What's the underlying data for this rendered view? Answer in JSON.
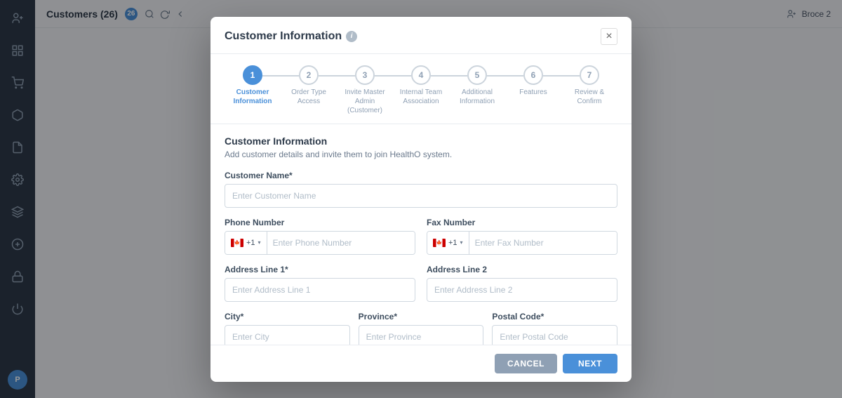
{
  "app": {
    "title": "Customers (26)",
    "badge": "26",
    "user": "Broce 2"
  },
  "sidebar": {
    "icons": [
      {
        "name": "add-user-icon",
        "symbol": "👤",
        "active": false
      },
      {
        "name": "grid-icon",
        "symbol": "⊞",
        "active": false
      },
      {
        "name": "cart-icon",
        "symbol": "🛒",
        "active": false
      },
      {
        "name": "package-icon",
        "symbol": "📦",
        "active": false
      },
      {
        "name": "file-icon",
        "symbol": "📄",
        "active": false
      },
      {
        "name": "settings-icon",
        "symbol": "⚙",
        "active": false
      },
      {
        "name": "layers-icon",
        "symbol": "◫",
        "active": false
      },
      {
        "name": "plus-circle-icon",
        "symbol": "⊕",
        "active": false
      },
      {
        "name": "lock-icon",
        "symbol": "🔒",
        "active": false
      },
      {
        "name": "power-icon",
        "symbol": "⏻",
        "active": false
      }
    ],
    "avatar_label": "P"
  },
  "modal": {
    "title": "Customer Information",
    "close_label": "×",
    "steps": [
      {
        "number": "1",
        "label": "Customer\nInformation",
        "active": true
      },
      {
        "number": "2",
        "label": "Order Type Access",
        "active": false
      },
      {
        "number": "3",
        "label": "Invite Master Admin (Customer)",
        "active": false
      },
      {
        "number": "4",
        "label": "Internal Team Association",
        "active": false
      },
      {
        "number": "5",
        "label": "Additional Information",
        "active": false
      },
      {
        "number": "6",
        "label": "Features",
        "active": false
      },
      {
        "number": "7",
        "label": "Review & Confirm",
        "active": false
      }
    ],
    "section_title": "Customer Information",
    "section_subtitle": "Add customer details and invite them to join HealthO system.",
    "form": {
      "customer_name_label": "Customer Name*",
      "customer_name_placeholder": "Enter Customer Name",
      "phone_number_label": "Phone Number",
      "phone_number_placeholder": "Enter Phone Number",
      "phone_prefix": "+1",
      "fax_number_label": "Fax Number",
      "fax_number_placeholder": "Enter Fax Number",
      "fax_prefix": "+1",
      "address_line1_label": "Address Line 1*",
      "address_line1_placeholder": "Enter Address Line 1",
      "address_line2_label": "Address Line 2",
      "address_line2_placeholder": "Enter Address Line 2",
      "city_label": "City*",
      "city_placeholder": "Enter City",
      "province_label": "Province*",
      "province_placeholder": "Enter Province",
      "postal_code_label": "Postal Code*",
      "postal_code_placeholder": "Enter Postal Code"
    },
    "footer": {
      "cancel_label": "CANCEL",
      "next_label": "NEXT"
    }
  }
}
